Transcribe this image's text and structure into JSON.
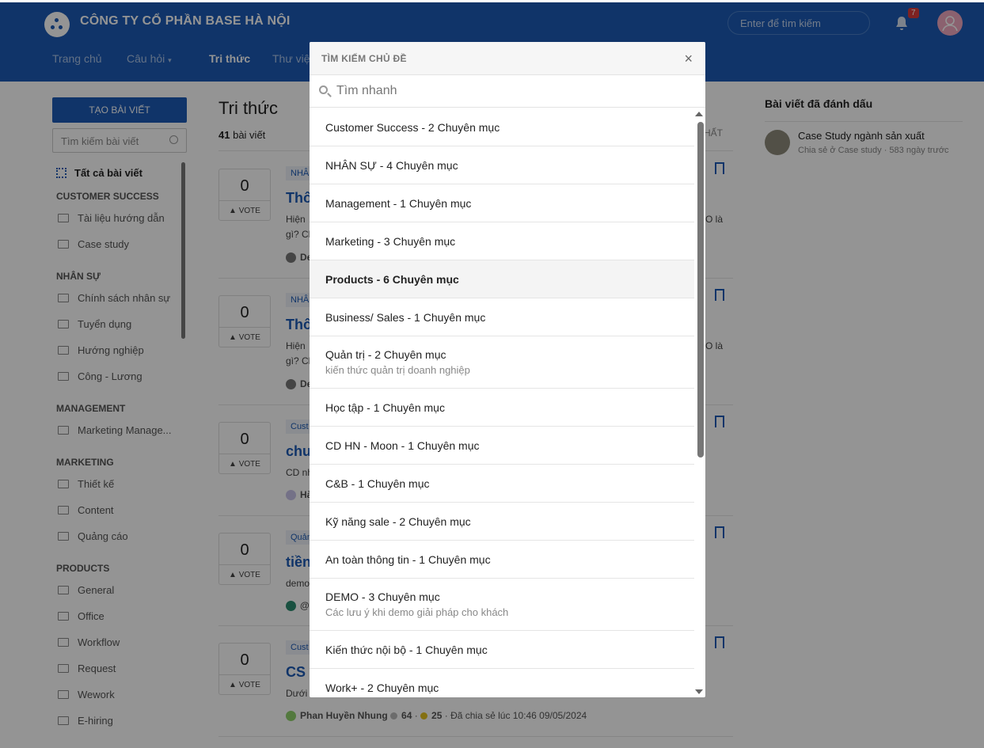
{
  "header": {
    "company": "CÔNG TY CỔ PHẦN BASE HÀ NỘI",
    "search_placeholder": "Enter để tìm kiếm",
    "notification_count": "7",
    "nav": [
      "Trang chủ",
      "Câu hỏi",
      "Tri thức",
      "Thư việ"
    ]
  },
  "sidebar": {
    "create_button": "TẠO BÀI VIẾT",
    "search_placeholder": "Tìm kiếm bài viết",
    "all_label": "Tất cả bài viết",
    "groups": [
      {
        "title": "CUSTOMER SUCCESS",
        "items": [
          "Tài liệu hướng dẫn",
          "Case study"
        ]
      },
      {
        "title": "NHÂN SỰ",
        "items": [
          "Chính sách nhân sự",
          "Tuyển dụng",
          "Hướng nghiệp",
          "Công - Lương"
        ]
      },
      {
        "title": "MANAGEMENT",
        "items": [
          "Marketing Manage..."
        ]
      },
      {
        "title": "MARKETING",
        "items": [
          "Thiết kế",
          "Content",
          "Quảng cáo"
        ]
      },
      {
        "title": "PRODUCTS",
        "items": [
          "General",
          "Office",
          "Workflow",
          "Request",
          "Wework",
          "E-hiring"
        ]
      }
    ]
  },
  "main": {
    "title": "Tri thức",
    "count_num": "41",
    "count_label": "bài viết",
    "sort_label": "HẤT",
    "vote_label": "VOTE",
    "cards": [
      {
        "votes": "0",
        "tag": "NHÂ",
        "title": "Thô",
        "desc1": "Hiện",
        "desc2": "gì? Cl",
        "desc_end": "O là",
        "author": "De"
      },
      {
        "votes": "0",
        "tag": "NHÂ",
        "title": "Thô",
        "desc1": "Hiện",
        "desc2": "gì? Cl",
        "desc_end": "O là",
        "author": "De"
      },
      {
        "votes": "0",
        "tag": "Cust",
        "title": "chu",
        "desc1": "CD nh",
        "desc2": "",
        "desc_end": "",
        "author": "Hà"
      },
      {
        "votes": "0",
        "tag": "Quản",
        "title": "tiền",
        "desc1": "demo",
        "desc2": "",
        "desc_end": "",
        "author": "@"
      },
      {
        "votes": "0",
        "tag": "Cust",
        "title": "CS I",
        "desc1": "Dưới",
        "desc2": "",
        "desc_end": "",
        "author": "Phan Huyền Nhung"
      }
    ],
    "last_meta": {
      "author": "Phan Huyền Nhung",
      "score": "64",
      "points": "25",
      "shared": "· Đã chia sẻ lúc 10:46 09/05/2024"
    }
  },
  "right": {
    "title": "Bài viết đã đánh dấu",
    "item_title": "Case Study ngành sản xuất",
    "item_sub": "Chia sẻ ở Case study · 583 ngày trước"
  },
  "modal": {
    "title": "TÌM KIẾM CHỦ ĐỀ",
    "close": "×",
    "search_placeholder": "Tìm nhanh",
    "items": [
      {
        "label": "Customer Success - 2 Chuyên mục",
        "sub": ""
      },
      {
        "label": "NHÂN SỰ - 4 Chuyên mục",
        "sub": ""
      },
      {
        "label": "Management - 1 Chuyên mục",
        "sub": ""
      },
      {
        "label": "Marketing - 3 Chuyên mục",
        "sub": ""
      },
      {
        "label": "Products - 6 Chuyên mục",
        "sub": ""
      },
      {
        "label": "Business/ Sales - 1 Chuyên mục",
        "sub": ""
      },
      {
        "label": "Quản trị - 2 Chuyên mục",
        "sub": "kiến thức quản trị doanh nghiệp"
      },
      {
        "label": "Học tập - 1 Chuyên mục",
        "sub": ""
      },
      {
        "label": "CD HN - Moon - 1 Chuyên mục",
        "sub": ""
      },
      {
        "label": "C&B - 1 Chuyên mục",
        "sub": ""
      },
      {
        "label": "Kỹ năng sale - 2 Chuyên mục",
        "sub": ""
      },
      {
        "label": "An toàn thông tin - 1 Chuyên mục",
        "sub": ""
      },
      {
        "label": "DEMO - 3 Chuyên mục",
        "sub": "Các lưu ý khi demo giải pháp cho khách"
      },
      {
        "label": "Kiến thức nội bộ - 1 Chuyên mục",
        "sub": ""
      },
      {
        "label": "Work+ - 2 Chuyên mục",
        "sub": ""
      }
    ],
    "highlighted_index": 4
  }
}
